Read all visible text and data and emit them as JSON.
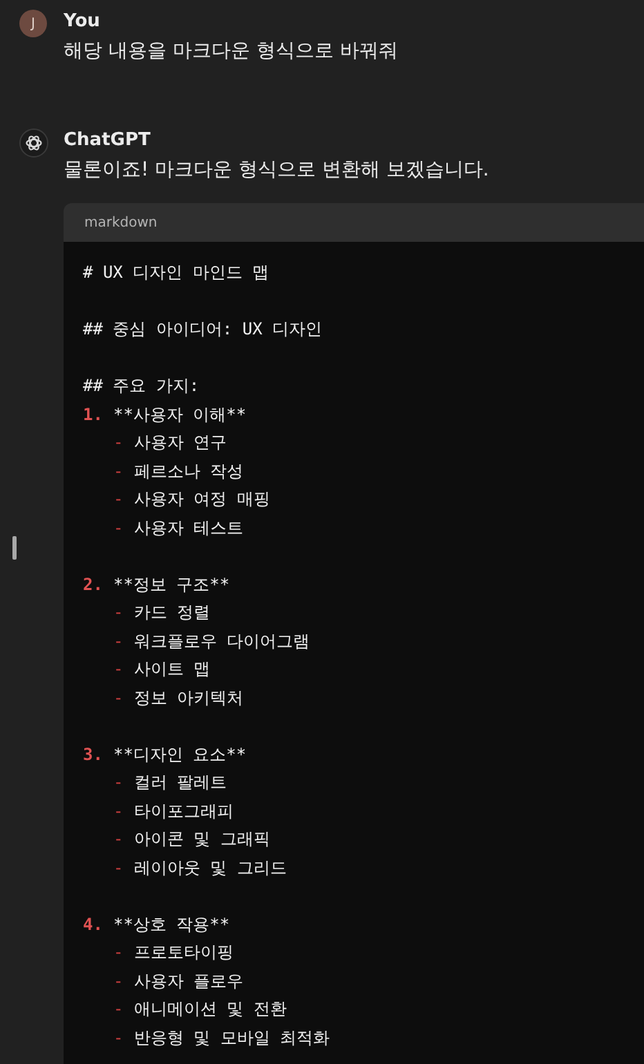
{
  "messages": [
    {
      "kind": "user",
      "avatar": "J",
      "author": "You",
      "text": "해당 내용을 마크다운 형식으로 바꿔줘"
    },
    {
      "kind": "assistant",
      "author": "ChatGPT",
      "text": "물론이죠! 마크다운 형식으로 변환해 보겠습니다.",
      "code_block": {
        "language": "markdown",
        "lines": [
          {
            "kind": "text",
            "text": "# UX 디자인 마인드 맵"
          },
          {
            "kind": "blank"
          },
          {
            "kind": "text",
            "text": "## 중심 아이디어: UX 디자인"
          },
          {
            "kind": "blank"
          },
          {
            "kind": "text",
            "text": "## 주요 가지:"
          },
          {
            "kind": "numbered",
            "marker": "1.",
            "text": "**사용자 이해**"
          },
          {
            "kind": "bullet",
            "marker": "-",
            "text": "사용자 연구"
          },
          {
            "kind": "bullet",
            "marker": "-",
            "text": "페르소나 작성"
          },
          {
            "kind": "bullet",
            "marker": "-",
            "text": "사용자 여정 매핑"
          },
          {
            "kind": "bullet",
            "marker": "-",
            "text": "사용자 테스트"
          },
          {
            "kind": "blank"
          },
          {
            "kind": "numbered",
            "marker": "2.",
            "text": "**정보 구조**"
          },
          {
            "kind": "bullet",
            "marker": "-",
            "text": "카드 정렬"
          },
          {
            "kind": "bullet",
            "marker": "-",
            "text": "워크플로우 다이어그램"
          },
          {
            "kind": "bullet",
            "marker": "-",
            "text": "사이트 맵"
          },
          {
            "kind": "bullet",
            "marker": "-",
            "text": "정보 아키텍처"
          },
          {
            "kind": "blank"
          },
          {
            "kind": "numbered",
            "marker": "3.",
            "text": "**디자인 요소**"
          },
          {
            "kind": "bullet",
            "marker": "-",
            "text": "컬러 팔레트"
          },
          {
            "kind": "bullet",
            "marker": "-",
            "text": "타이포그래피"
          },
          {
            "kind": "bullet",
            "marker": "-",
            "text": "아이콘 및 그래픽"
          },
          {
            "kind": "bullet",
            "marker": "-",
            "text": "레이아웃 및 그리드"
          },
          {
            "kind": "blank"
          },
          {
            "kind": "numbered",
            "marker": "4.",
            "text": "**상호 작용**"
          },
          {
            "kind": "bullet",
            "marker": "-",
            "text": "프로토타이핑"
          },
          {
            "kind": "bullet",
            "marker": "-",
            "text": "사용자 플로우"
          },
          {
            "kind": "bullet",
            "marker": "-",
            "text": "애니메이션 및 전환"
          },
          {
            "kind": "bullet",
            "marker": "-",
            "text": "반응형 및 모바일 최적화"
          }
        ]
      }
    }
  ]
}
